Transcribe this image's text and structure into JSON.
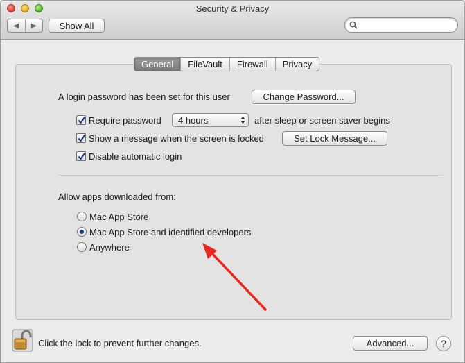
{
  "window": {
    "title": "Security & Privacy"
  },
  "toolbar": {
    "back_glyph": "◀",
    "forward_glyph": "▶",
    "show_all_label": "Show All",
    "search_placeholder": ""
  },
  "tabs": [
    {
      "label": "General",
      "selected": true
    },
    {
      "label": "FileVault",
      "selected": false
    },
    {
      "label": "Firewall",
      "selected": false
    },
    {
      "label": "Privacy",
      "selected": false
    }
  ],
  "general": {
    "login_password_text": "A login password has been set for this user",
    "change_password_label": "Change Password...",
    "require_password": {
      "label": "Require password",
      "checked": true,
      "delay_value": "4 hours",
      "suffix": "after sleep or screen saver begins"
    },
    "show_message": {
      "label": "Show a message when the screen is locked",
      "checked": true,
      "button_label": "Set Lock Message..."
    },
    "disable_auto_login": {
      "label": "Disable automatic login",
      "checked": true
    }
  },
  "downloads": {
    "heading": "Allow apps downloaded from:",
    "options": [
      {
        "label": "Mac App Store",
        "selected": false
      },
      {
        "label": "Mac App Store and identified developers",
        "selected": true
      },
      {
        "label": "Anywhere",
        "selected": false
      }
    ]
  },
  "footer": {
    "lock_text": "Click the lock to prevent further changes.",
    "advanced_label": "Advanced...",
    "help_glyph": "?"
  },
  "colors": {
    "annotation_arrow": "#e8271f",
    "radio_selected": "#1c3f94",
    "checkmark": "#1b3a7a"
  }
}
